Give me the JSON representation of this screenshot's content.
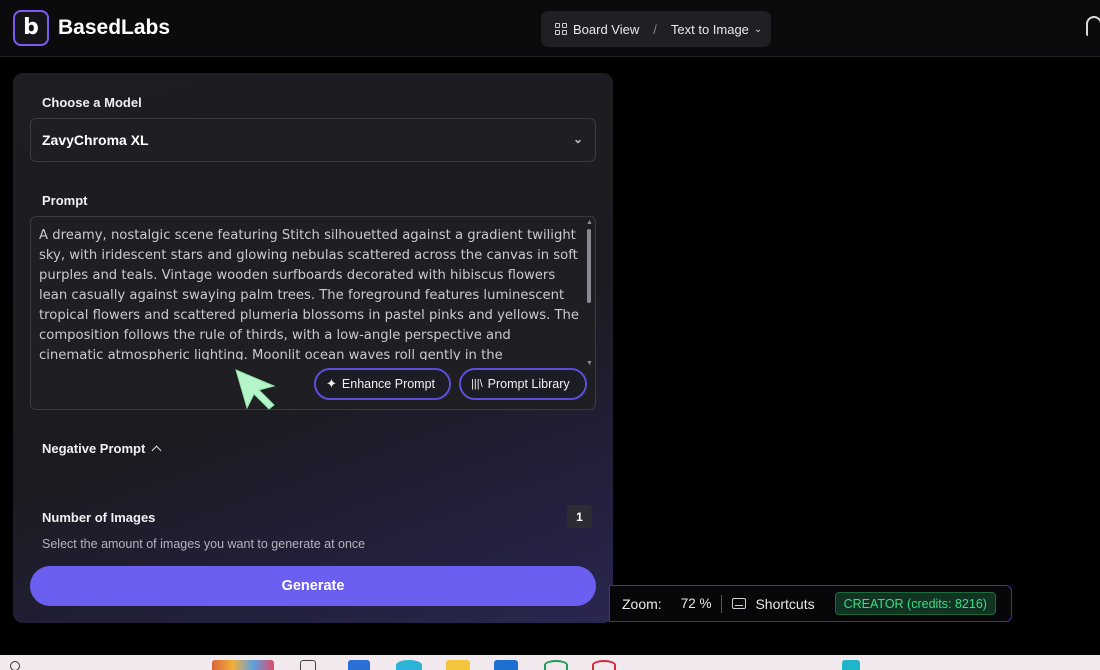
{
  "header": {
    "logo_glyph": "b",
    "brand": "BasedLabs",
    "breadcrumb": {
      "view": "Board View",
      "separator": "/",
      "current": "Text to Image"
    }
  },
  "panel": {
    "model_label": "Choose a Model",
    "model_value": "ZavyChroma XL",
    "prompt_label": "Prompt",
    "prompt_text": "A dreamy, nostalgic scene featuring Stitch silhouetted against a gradient twilight sky, with iridescent stars and glowing nebulas scattered across the canvas in soft purples and teals. Vintage wooden surfboards decorated with hibiscus flowers lean casually against swaying palm trees. The foreground features luminescent tropical flowers and scattered plumeria blossoms in pastel pinks and yellows. The composition follows the rule of thirds, with a low-angle perspective and cinematic atmospheric lighting. Moonlit ocean waves roll gently in the",
    "enhance_label": "Enhance Prompt",
    "library_label": "Prompt Library",
    "negative_label": "Negative Prompt",
    "images_label": "Number of Images",
    "images_count": "1",
    "images_helper": "Select the amount of images you want to generate at once",
    "generate_label": "Generate"
  },
  "status": {
    "zoom_label": "Zoom:",
    "zoom_value": "72 %",
    "shortcuts_label": "Shortcuts",
    "credits_label": "CREATOR (credits: 8216)"
  },
  "colors": {
    "accent": "#6a5ff0",
    "pill_border": "#5b4fd8",
    "credits_green": "#3ddc84",
    "cursor_green": "#b6f5c9"
  }
}
